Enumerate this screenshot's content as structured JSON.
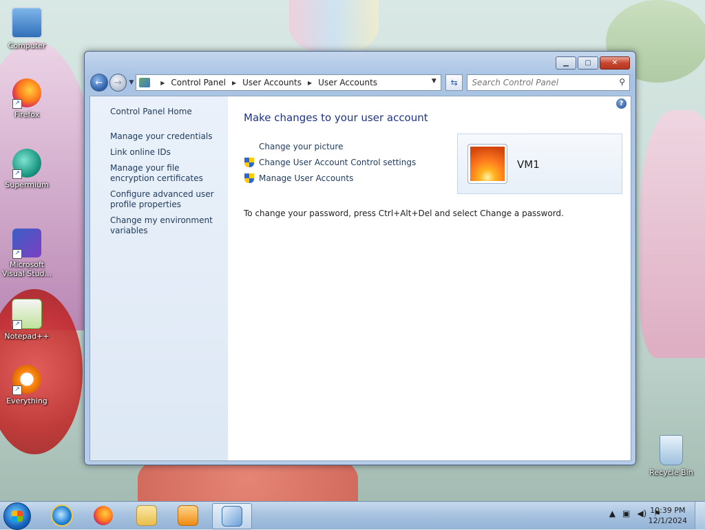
{
  "desktop": {
    "icons": [
      {
        "label": "Computer"
      },
      {
        "label": "Firefox"
      },
      {
        "label": "Supermium"
      },
      {
        "label": "Microsoft Visual Stud..."
      },
      {
        "label": "Notepad++"
      },
      {
        "label": "Everything"
      },
      {
        "label": "Recycle Bin"
      }
    ]
  },
  "window": {
    "address": {
      "crumbs": [
        "Control Panel",
        "User Accounts",
        "User Accounts"
      ]
    },
    "search": {
      "placeholder": "Search Control Panel"
    },
    "left_pane": {
      "home": "Control Panel Home",
      "links": [
        "Manage your credentials",
        "Link online IDs",
        "Manage your file encryption certificates",
        "Configure advanced user profile properties",
        "Change my environment variables"
      ]
    },
    "main": {
      "title": "Make changes to your user account",
      "links": [
        {
          "label": "Change your picture",
          "shield": false
        },
        {
          "label": "Change User Account Control settings",
          "shield": true
        },
        {
          "label": "Manage User Accounts",
          "shield": true
        }
      ],
      "note": "To change your password, press Ctrl+Alt+Del and select Change a password.",
      "user": {
        "name": "VM1"
      },
      "help": "?"
    }
  },
  "taskbar": {
    "clock": {
      "time": "10:39 PM",
      "date": "12/1/2024"
    }
  }
}
